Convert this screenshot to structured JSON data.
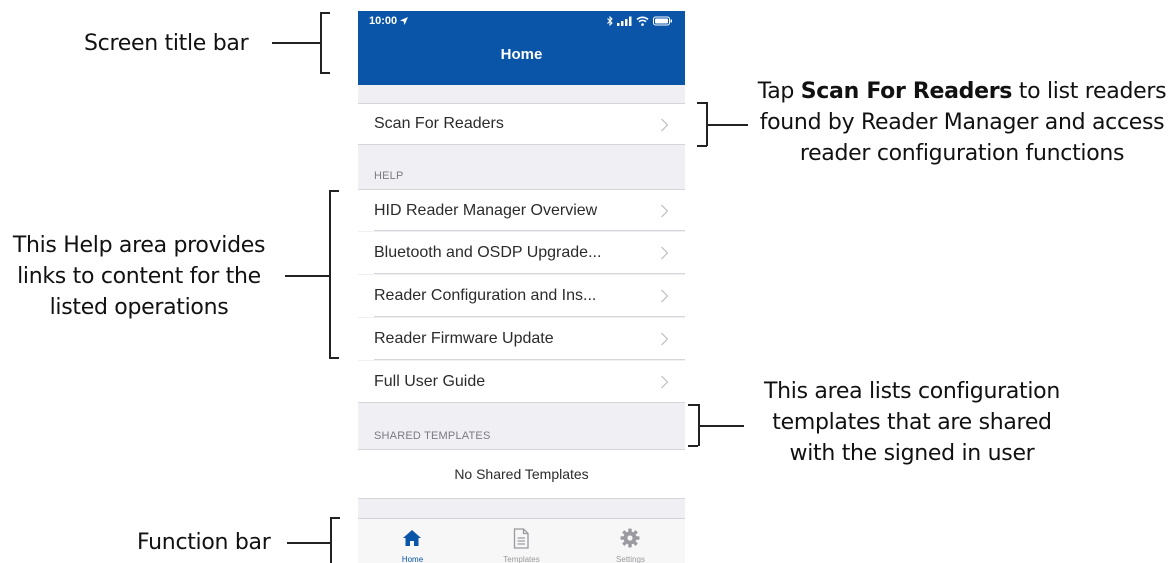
{
  "annotations": {
    "title_bar": "Screen title bar",
    "help_area": [
      "This Help area provides",
      "links to content for the",
      "listed operations"
    ],
    "function_bar": "Function bar",
    "scan": {
      "prefix": "Tap ",
      "bold": "Scan For Readers",
      "suffix_line1": " to list readers",
      "line2": "found by Reader Manager and access",
      "line3": "reader configuration functions"
    },
    "shared": [
      "This area lists configuration",
      "templates that are shared",
      "with the signed in user"
    ]
  },
  "phone": {
    "status_time": "10:00",
    "nav_title": "Home",
    "scan_row": "Scan For Readers",
    "help_header": "HELP",
    "help_items": [
      "HID Reader Manager Overview",
      "Bluetooth and OSDP Upgrade...",
      "Reader Configuration and Ins...",
      "Reader Firmware Update",
      "Full User Guide"
    ],
    "shared_header": "SHARED TEMPLATES",
    "no_templates": "No Shared Templates",
    "tabs": [
      {
        "label": "Home",
        "icon": "home-icon"
      },
      {
        "label": "Templates",
        "icon": "document-icon"
      },
      {
        "label": "Settings",
        "icon": "gear-icon"
      }
    ]
  },
  "colors": {
    "brand_blue": "#0a55a8",
    "background_gray": "#efeff4"
  }
}
